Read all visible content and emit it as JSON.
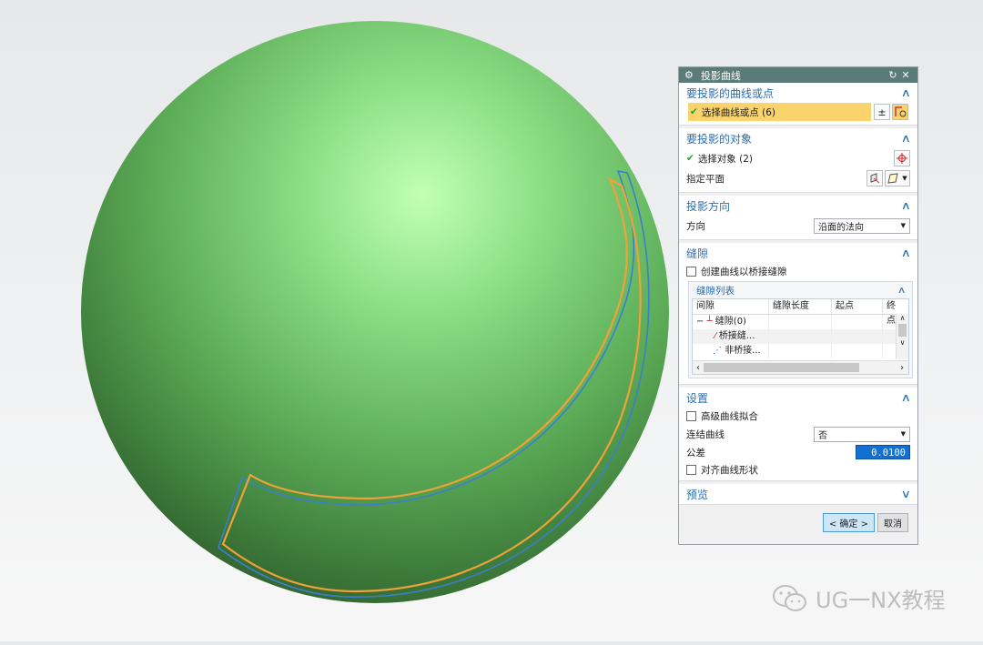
{
  "dialog": {
    "title": "投影曲线",
    "sections": {
      "curves": {
        "title": "要投影的曲线或点",
        "select_label": "选择曲线或点 (6)"
      },
      "objects": {
        "title": "要投影的对象",
        "select_label": "选择对象 (2)",
        "plane_label": "指定平面"
      },
      "direction": {
        "title": "投影方向",
        "direction_label": "方向",
        "direction_value": "沿面的法向"
      },
      "gaps": {
        "title": "缝隙",
        "create_bridge_label": "创建曲线以桥接缝隙",
        "create_bridge_checked": false,
        "list": {
          "title": "缝隙列表",
          "columns": [
            "间隙",
            "缝隙长度",
            "起点",
            "终点"
          ],
          "rows": [
            {
              "name": "缝隙(0)",
              "expander": "−"
            },
            {
              "name": "桥接缝...",
              "expander": ""
            },
            {
              "name": "非桥接...",
              "expander": ""
            }
          ]
        }
      },
      "settings": {
        "title": "设置",
        "advanced_fit_label": "高级曲线拟合",
        "advanced_fit_checked": false,
        "join_label": "连结曲线",
        "join_value": "否",
        "tolerance_label": "公差",
        "tolerance_value": "0.0100",
        "align_label": "对齐曲线形状",
        "align_checked": false
      },
      "preview": {
        "title": "预览"
      }
    },
    "buttons": {
      "ok": "< 确定 >",
      "cancel": "取消"
    }
  },
  "watermark": {
    "text": "UG一NX教程"
  },
  "colors": {
    "sphere": "#6cc26b",
    "curve_orange": "#f0a23a",
    "curve_blue": "#3a7fd0",
    "title_bar": "#5a7b78",
    "section_title": "#2a6fb3",
    "selection_highlight": "#fad36c"
  }
}
